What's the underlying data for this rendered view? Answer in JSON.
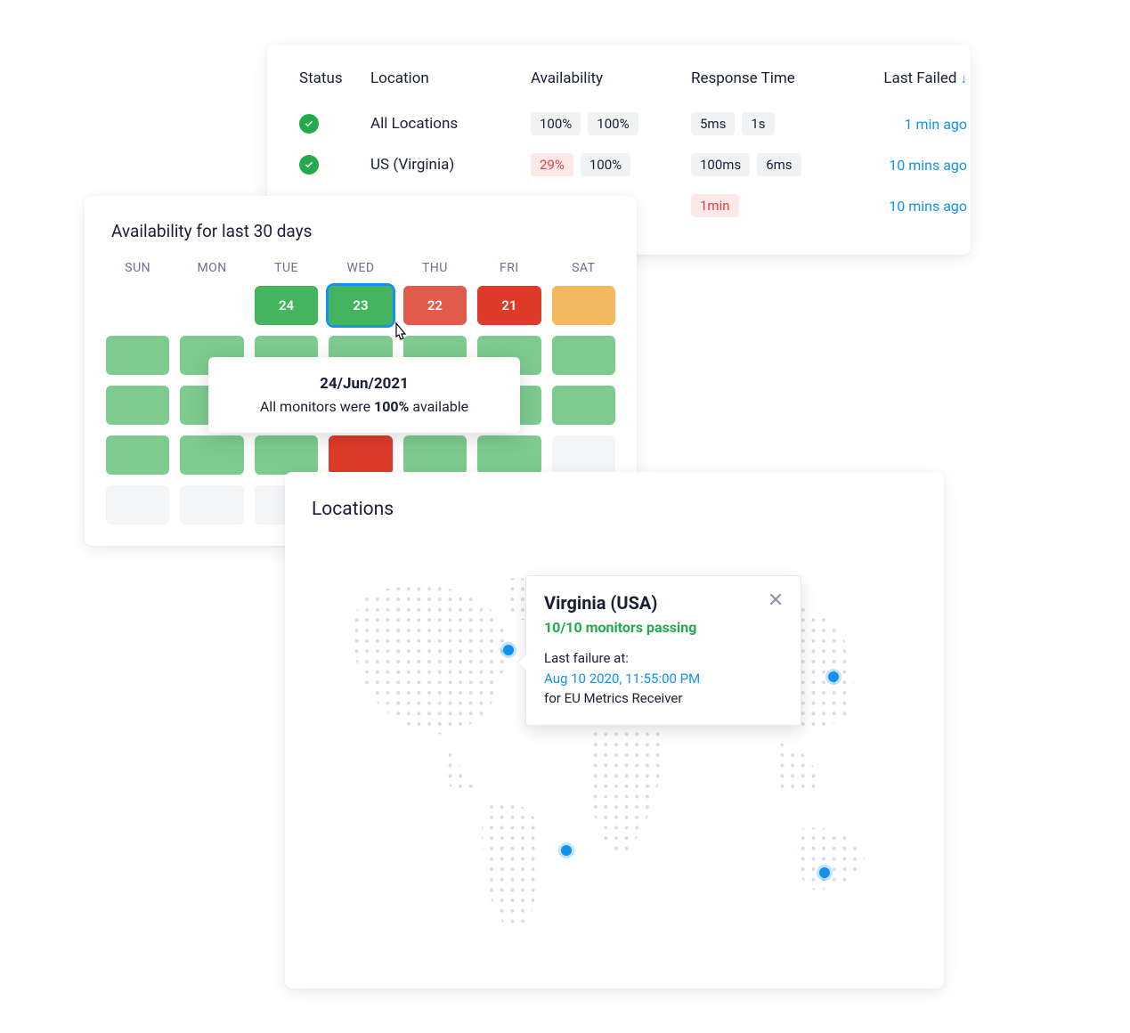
{
  "status_table": {
    "headers": {
      "status": "Status",
      "location": "Location",
      "availability": "Availability",
      "response_time": "Response Time",
      "last_failed": "Last Failed"
    },
    "rows": [
      {
        "location": "All Locations",
        "availability": [
          "100%",
          "100%"
        ],
        "availability_red": [
          false,
          false
        ],
        "response": [
          "5ms",
          "1s"
        ],
        "response_red": [
          false,
          false
        ],
        "last_failed": "1 min ago"
      },
      {
        "location": "US (Virginia)",
        "availability": [
          "29%",
          "100%"
        ],
        "availability_red": [
          true,
          false
        ],
        "response": [
          "100ms",
          "6ms"
        ],
        "response_red": [
          false,
          false
        ],
        "last_failed": "10 mins ago"
      },
      {
        "location": "",
        "availability": [],
        "availability_red": [],
        "response": [
          "1min"
        ],
        "response_red": [
          true
        ],
        "last_failed": "10 mins ago"
      }
    ]
  },
  "calendar": {
    "title": "Availability for last 30 days",
    "days_of_week": [
      "SUN",
      "MON",
      "TUE",
      "WED",
      "THU",
      "FRI",
      "SAT"
    ],
    "row1": [
      {
        "class": "c-blank",
        "label": ""
      },
      {
        "class": "c-blank",
        "label": ""
      },
      {
        "class": "c-green-dark",
        "label": "24"
      },
      {
        "class": "c-selected",
        "label": "23"
      },
      {
        "class": "c-red",
        "label": "22"
      },
      {
        "class": "c-red-dark",
        "label": "21"
      },
      {
        "class": "c-amber",
        "label": ""
      }
    ],
    "rows_rest": [
      [
        "c-green",
        "c-green",
        "c-green",
        "c-green",
        "c-green",
        "c-green",
        "c-green"
      ],
      [
        "c-green",
        "c-green",
        "c-green",
        "c-green",
        "c-green",
        "c-green",
        "c-green"
      ],
      [
        "c-green",
        "c-green",
        "c-green",
        "c-red-dark",
        "c-green",
        "c-green",
        "c-empty"
      ],
      [
        "c-empty",
        "c-empty",
        "c-empty",
        "c-blank",
        "c-blank",
        "c-blank",
        "c-blank"
      ]
    ],
    "tooltip": {
      "date": "24/Jun/2021",
      "prefix": "All monitors were ",
      "percent": "100%",
      "suffix": " available"
    }
  },
  "map": {
    "title": "Locations",
    "popover": {
      "title": "Virginia (USA)",
      "status": "10/10 monitors passing",
      "fail_label": "Last failure at:",
      "fail_time": "Aug 10 2020, 11:55:00 PM",
      "fail_for": "for EU Metrics Receiver"
    }
  },
  "colors": {
    "accent": "#1292ee",
    "green": "#22ab4b",
    "red": "#e44141"
  }
}
